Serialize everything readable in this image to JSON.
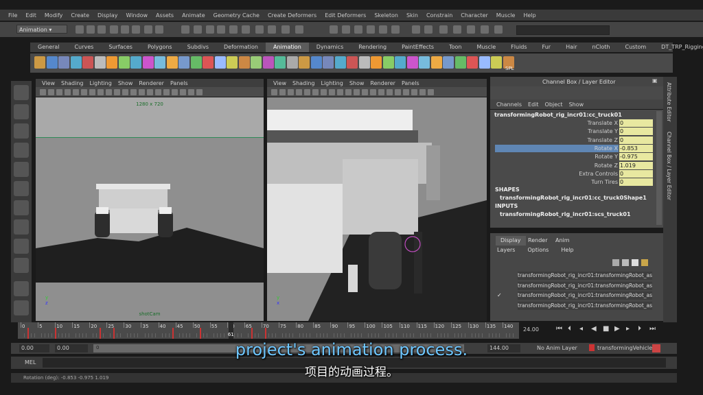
{
  "menubar": [
    "File",
    "Edit",
    "Modify",
    "Create",
    "Display",
    "Window",
    "Assets",
    "Animate",
    "Geometry Cache",
    "Create Deformers",
    "Edit Deformers",
    "Skeleton",
    "Skin",
    "Constrain",
    "Character",
    "Muscle",
    "Help"
  ],
  "status_line": {
    "mode": "Animation"
  },
  "shelf": {
    "tabs": [
      "General",
      "Curves",
      "Surfaces",
      "Polygons",
      "Subdivs",
      "Deformation",
      "Animation",
      "Dynamics",
      "Rendering",
      "PaintEffects",
      "Toon",
      "Muscle",
      "Fluids",
      "Fur",
      "Hair",
      "nCloth",
      "Custom",
      "DT_TRP_Rigging"
    ],
    "active_tab": "Animation",
    "last_icon_label": "SPL"
  },
  "viewport_left": {
    "menus": [
      "View",
      "Shading",
      "Lighting",
      "Show",
      "Renderer",
      "Panels"
    ],
    "resolution": "1280 x 720",
    "camera": "shotCam"
  },
  "viewport_right": {
    "menus": [
      "View",
      "Shading",
      "Lighting",
      "Show",
      "Renderer",
      "Panels"
    ]
  },
  "channel_box": {
    "title": "Channel Box / Layer Editor",
    "menus": [
      "Channels",
      "Edit",
      "Object",
      "Show"
    ],
    "object": "transformingRobot_rig_incr01:cc_truck01",
    "attributes": [
      {
        "label": "Translate X",
        "value": "0",
        "selected": false
      },
      {
        "label": "Translate Y",
        "value": "0",
        "selected": false
      },
      {
        "label": "Translate Z",
        "value": "0",
        "selected": false
      },
      {
        "label": "Rotate X",
        "value": "-0.853",
        "selected": true
      },
      {
        "label": "Rotate Y",
        "value": "-0.975",
        "selected": false
      },
      {
        "label": "Rotate Z",
        "value": "1.019",
        "selected": false
      },
      {
        "label": "Extra Controls",
        "value": "0",
        "selected": false
      },
      {
        "label": "Turn Tires",
        "value": "0",
        "selected": false
      }
    ],
    "shapes_header": "SHAPES",
    "shape": "transformingRobot_rig_incr01:cc_truck0Shape1",
    "inputs_header": "INPUTS",
    "input": "transformingRobot_rig_incr01:scs_truck01"
  },
  "layer_editor": {
    "tabs": [
      "Display",
      "Render",
      "Anim"
    ],
    "active_tab": "Display",
    "menus": [
      "Layers",
      "Options",
      "Help"
    ],
    "layers": [
      {
        "name": "transformingRobot_rig_incr01:transformingRobot_as",
        "visible": ""
      },
      {
        "name": "transformingRobot_rig_incr01:transformingRobot_as",
        "visible": ""
      },
      {
        "name": "transformingRobot_rig_incr01:transformingRobot_as",
        "visible": "✓"
      },
      {
        "name": "transformingRobot_rig_incr01:transformingRobot_as",
        "visible": ""
      }
    ]
  },
  "side_tabs": [
    "Attribute Editor",
    "Channel Box / Layer Editor"
  ],
  "timeline": {
    "ticks": [
      "0",
      "5",
      "10",
      "15",
      "20",
      "25",
      "30",
      "35",
      "40",
      "45",
      "50",
      "55",
      "60",
      "65",
      "70",
      "75",
      "80",
      "85",
      "90",
      "95",
      "100",
      "105",
      "110",
      "115",
      "120",
      "125",
      "130",
      "135",
      "140"
    ],
    "current_frame": "61",
    "current_frame_value": 61,
    "end_frame_display": "24.00"
  },
  "range": {
    "start": "0.00",
    "start_inner": "0.00",
    "end": "144.00",
    "slider_start": "0",
    "anim_layer": "No Anim Layer",
    "character": "transformingVehicle01"
  },
  "command_line": {
    "label": "MEL"
  },
  "help_line": {
    "text": "Rotation (deg):   -0.853   -0.975   1.019"
  },
  "subtitles": {
    "english": "project's animation process.",
    "chinese": "项目的动画过程。"
  }
}
